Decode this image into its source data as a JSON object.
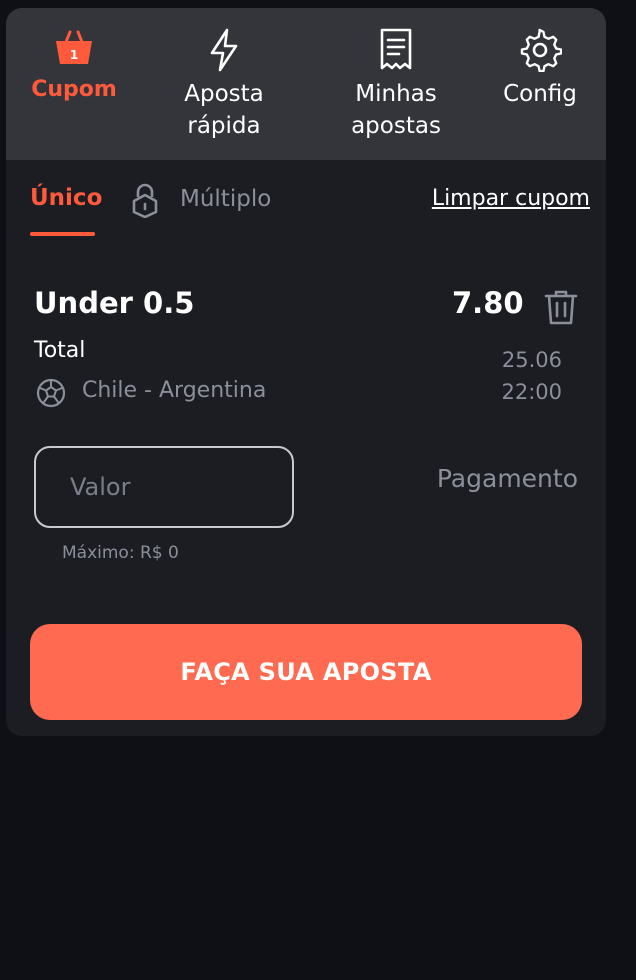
{
  "nav": {
    "items": [
      {
        "label": "Cupom",
        "badge": "1",
        "icon": "basket-icon"
      },
      {
        "label": "Aposta\nrápida",
        "icon": "lightning-icon"
      },
      {
        "label": "Minhas\napostas",
        "icon": "receipt-icon"
      },
      {
        "label": "Config",
        "icon": "gear-icon"
      }
    ]
  },
  "tabs": {
    "single": "Único",
    "multiple": "Múltiplo",
    "clear": "Limpar cupom"
  },
  "bet": {
    "selection": "Under 0.5",
    "odds": "7.80",
    "market": "Total",
    "match": "Chile - Argentina",
    "date": "25.06",
    "time": "22:00",
    "stake_placeholder": "Valor",
    "payout_label": "Pagamento",
    "max_label": "Máximo: R$ 0"
  },
  "cta": {
    "label": "FAÇA SUA APOSTA"
  },
  "colors": {
    "accent": "#ff5a3c",
    "cta": "#ff6a50",
    "panel": "#1c1d23",
    "nav": "#33353a",
    "muted": "#8b8f9a"
  }
}
